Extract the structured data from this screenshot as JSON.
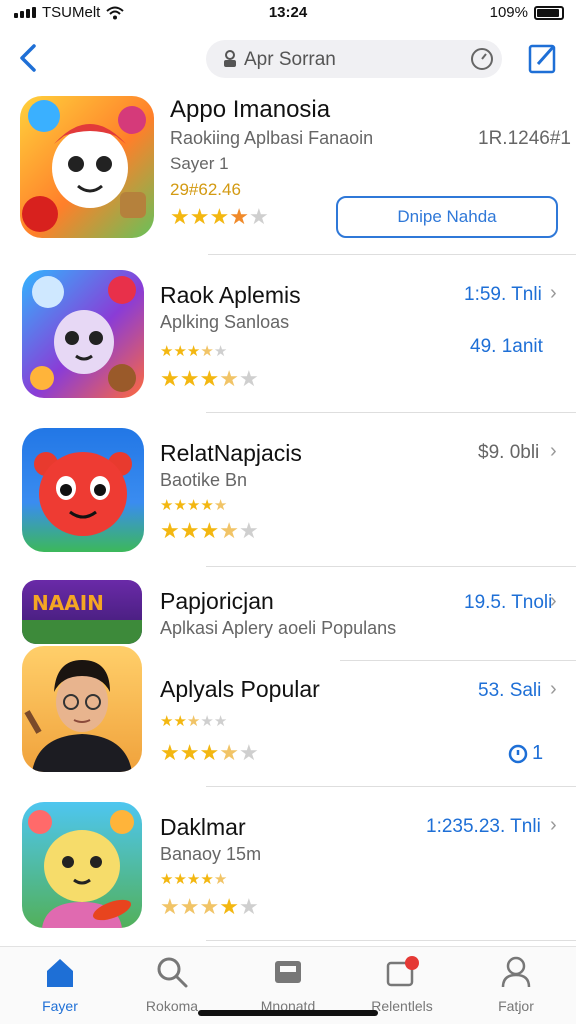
{
  "status_bar": {
    "carrier": "TSUMelt",
    "time": "13:24",
    "battery": "109%"
  },
  "search": {
    "placeholder": "Apr Sorran"
  },
  "apps": [
    {
      "name": "Appo Imanosia",
      "subtitle": "Raokiing Aplbasi Fanaoin",
      "category": "Sayer 1",
      "price": "29#62.46",
      "size": "1R.1246#1",
      "button": "Dnipe Nahda",
      "rating": 3.5
    },
    {
      "name": "Raok Aplemis",
      "subtitle": "Aplking Sanloas",
      "size": "1:59. Tnli",
      "secondary": "49. 1anit",
      "rating": 3
    },
    {
      "name": "RelatNapjacis",
      "subtitle": "Baotike Bn",
      "size": "$9. 0bli",
      "rating": 3
    },
    {
      "name": "Papjoricjan",
      "subtitle": "Aplkasi Aplery aoeli Populans",
      "size": "19.5. Tnoli",
      "banner_text": "NAAIN"
    },
    {
      "name": "Aplyals Popular",
      "size": "53. Sali",
      "badge_count": "1",
      "rating": 3
    },
    {
      "name": "Daklmar",
      "subtitle": "Banaoy 15m",
      "size": "1:235.23. Tnli",
      "rating": 4
    }
  ],
  "tabs": [
    {
      "label": "Fayer",
      "icon": "home-icon"
    },
    {
      "label": "Rokoma",
      "icon": "search-icon"
    },
    {
      "label": "Mnonatd",
      "icon": "apps-icon"
    },
    {
      "label": "Relentlels",
      "icon": "updates-icon"
    },
    {
      "label": "Fatjor",
      "icon": "profile-icon"
    }
  ],
  "colors": {
    "accent": "#1e6fd6",
    "star": "#f3b711",
    "price": "#d39a12"
  }
}
